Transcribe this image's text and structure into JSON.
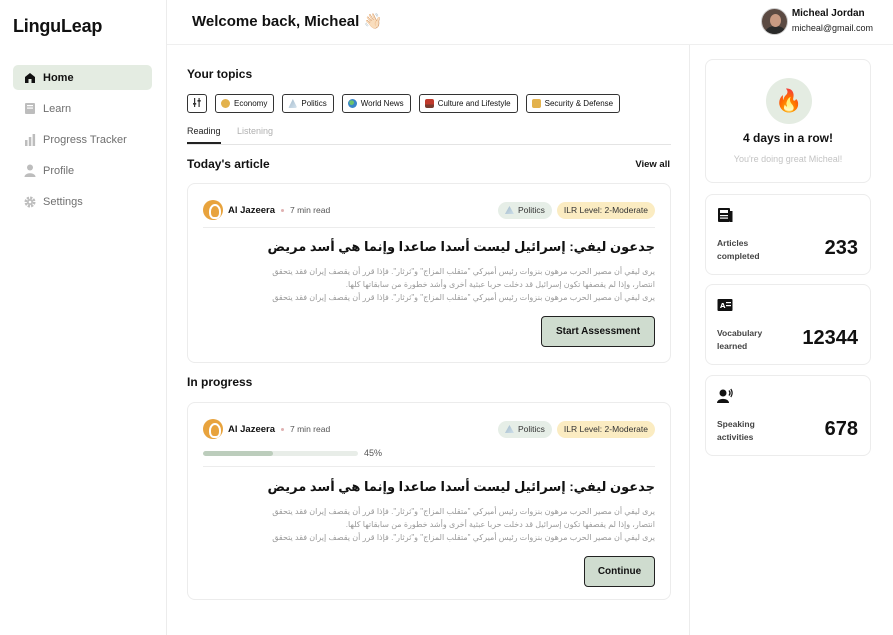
{
  "app": {
    "logo": "LinguLeap"
  },
  "sidebar": {
    "items": [
      {
        "label": "Home",
        "icon": "home-icon",
        "active": true
      },
      {
        "label": "Learn",
        "icon": "book-icon",
        "active": false
      },
      {
        "label": "Progress Tracker",
        "icon": "bar-chart-icon",
        "active": false
      },
      {
        "label": "Profile",
        "icon": "user-icon",
        "active": false
      },
      {
        "label": "Settings",
        "icon": "gear-icon",
        "active": false
      }
    ]
  },
  "header": {
    "welcome": "Welcome back, Micheal 👋🏻",
    "user_name": "Micheal Jordan",
    "user_email": "micheal@gmail.com"
  },
  "topics": {
    "title": "Your topics",
    "chips": [
      {
        "label": "Economy",
        "icon": "money-bag-icon"
      },
      {
        "label": "Politics",
        "icon": "landmark-icon"
      },
      {
        "label": "World News",
        "icon": "globe-icon"
      },
      {
        "label": "Culture and Lifestyle",
        "icon": "culture-icon"
      },
      {
        "label": "Security & Defense",
        "icon": "lock-icon"
      }
    ],
    "tabs": [
      "Reading",
      "Listening"
    ]
  },
  "today": {
    "title": "Today's article",
    "view_all": "View all",
    "source": "Al Jazeera",
    "read_time": "7 min read",
    "topic_badge": "Politics",
    "level_badge": "ILR Level: 2-Moderate",
    "headline": "جدعون ليفي: إسرائيل ليست أسدا صاعدا وإنما هي أسد مريض",
    "excerpt_line1": "يرى ليفي أن مصير الحرب مرهون بنزوات رئيس أميركي \"متقلب المزاج\" و\"ثرثار\". فإذا قرر أن يقصف إيران فقد يتحقق",
    "excerpt_line2": "انتصار، وإذا لم يقصفها تكون إسرائيل قد دخلت حربا عبثية أخرى وأشد خطورة من سابقاتها كلها.",
    "excerpt_line3": "يرى ليفي أن مصير الحرب مرهون بنزوات رئيس أميركي \"متقلب المزاج\" و\"ثرثار\". فإذا قرر أن يقصف إيران فقد يتحقق",
    "button": "Start Assessment"
  },
  "in_progress": {
    "title": "In progress",
    "source": "Al Jazeera",
    "read_time": "7 min read",
    "topic_badge": "Politics",
    "level_badge": "ILR Level: 2-Moderate",
    "progress": 45,
    "progress_label": "45%",
    "headline": "جدعون ليفي: إسرائيل ليست أسدا صاعدا وإنما هي أسد مريض",
    "excerpt_line1": "يرى ليفي أن مصير الحرب مرهون بنزوات رئيس أميركي \"متقلب المزاج\" و\"ثرثار\". فإذا قرر أن يقصف إيران فقد يتحقق",
    "excerpt_line2": "انتصار، وإذا لم يقصفها تكون إسرائيل قد دخلت حربا عبثية أخرى وأشد خطورة من سابقاتها كلها.",
    "excerpt_line3": "يرى ليفي أن مصير الحرب مرهون بنزوات رئيس أميركي \"متقلب المزاج\" و\"ثرثار\". فإذا قرر أن يقصف إيران فقد يتحقق",
    "button": "Continue"
  },
  "streak": {
    "icon": "fire-icon",
    "title": "4 days in a row!",
    "subtitle": "You're doing great Micheal!"
  },
  "stats": [
    {
      "label": "Articles completed",
      "value": "233",
      "icon": "newspaper-icon"
    },
    {
      "label": "Vocabulary learned",
      "value": "12344",
      "icon": "dictionary-icon"
    },
    {
      "label": "Speaking activities",
      "value": "678",
      "icon": "speaking-icon"
    }
  ],
  "colors": {
    "accent": "#e4ece2",
    "button": "#cfdccf",
    "level_badge": "#fbecc2"
  }
}
